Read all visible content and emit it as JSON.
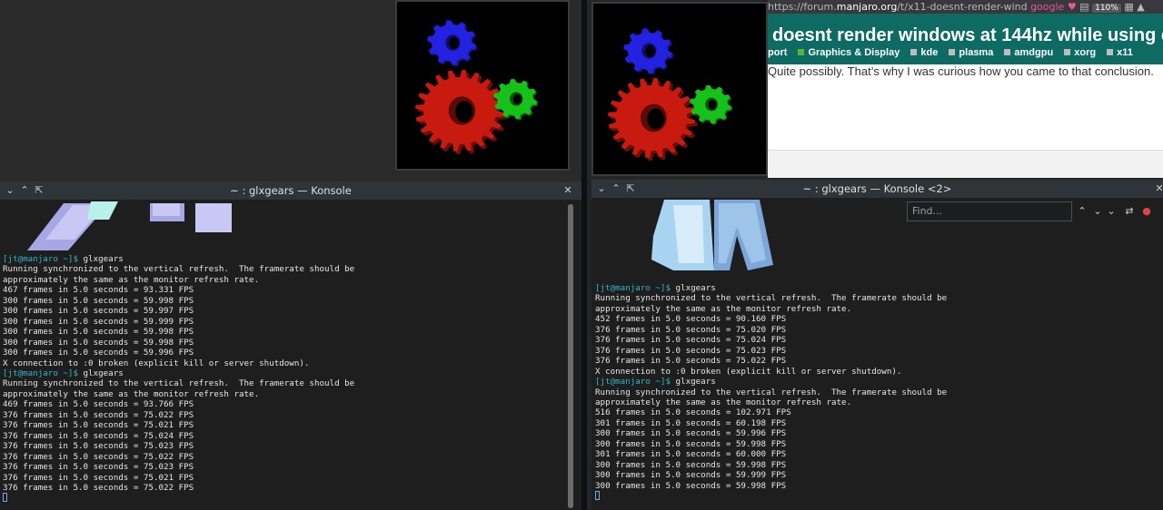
{
  "colors": {
    "blue_gear": "#2222e0",
    "red_gear": "#c91a0f",
    "green_gear": "#16c21a",
    "prompt": "#2fb6c7",
    "topic_bar": "#0d6b63"
  },
  "browser": {
    "url_prefix": "https://forum.",
    "url_domain": "manjaro.org",
    "url_path": "/t/x11-doesnt-render-wind",
    "search_engine": "google",
    "zoom": "110%",
    "topic_title": "doesnt render windows at 144hz while using d",
    "tags": [
      "port",
      "Graphics & Display",
      "kde",
      "plasma",
      "amdgpu",
      "xorg",
      "x11"
    ],
    "post_text": "Quite possibly. That’s why I was curious how you came to that conclusion."
  },
  "konsole_left": {
    "title": "~ : glxgears — Konsole",
    "lines": [
      {
        "prompt": "[jt@manjaro ~]$",
        "cmd": " glxgears"
      },
      {
        "text": "Running synchronized to the vertical refresh.  The framerate should be"
      },
      {
        "text": "approximately the same as the monitor refresh rate."
      },
      {
        "text": "467 frames in 5.0 seconds = 93.331 FPS"
      },
      {
        "text": "300 frames in 5.0 seconds = 59.998 FPS"
      },
      {
        "text": "300 frames in 5.0 seconds = 59.997 FPS"
      },
      {
        "text": "300 frames in 5.0 seconds = 59.999 FPS"
      },
      {
        "text": "300 frames in 5.0 seconds = 59.998 FPS"
      },
      {
        "text": "300 frames in 5.0 seconds = 59.998 FPS"
      },
      {
        "text": "300 frames in 5.0 seconds = 59.996 FPS"
      },
      {
        "text": "X connection to :0 broken (explicit kill or server shutdown)."
      },
      {
        "prompt": "[jt@manjaro ~]$",
        "cmd": " glxgears"
      },
      {
        "text": "Running synchronized to the vertical refresh.  The framerate should be"
      },
      {
        "text": "approximately the same as the monitor refresh rate."
      },
      {
        "text": "469 frames in 5.0 seconds = 93.766 FPS"
      },
      {
        "text": "376 frames in 5.0 seconds = 75.022 FPS"
      },
      {
        "text": "376 frames in 5.0 seconds = 75.021 FPS"
      },
      {
        "text": "376 frames in 5.0 seconds = 75.024 FPS"
      },
      {
        "text": "376 frames in 5.0 seconds = 75.023 FPS"
      },
      {
        "text": "376 frames in 5.0 seconds = 75.022 FPS"
      },
      {
        "text": "376 frames in 5.0 seconds = 75.023 FPS"
      },
      {
        "text": "376 frames in 5.0 seconds = 75.021 FPS"
      },
      {
        "text": "376 frames in 5.0 seconds = 75.022 FPS"
      },
      {
        "cursor": true
      }
    ]
  },
  "konsole_right": {
    "title": "~ : glxgears — Konsole <2>",
    "find_placeholder": "Find...",
    "lines": [
      {
        "prompt": "[jt@manjaro ~]$",
        "cmd": " glxgears"
      },
      {
        "text": "Running synchronized to the vertical refresh.  The framerate should be"
      },
      {
        "text": "approximately the same as the monitor refresh rate."
      },
      {
        "text": "452 frames in 5.0 seconds = 90.160 FPS"
      },
      {
        "text": "376 frames in 5.0 seconds = 75.020 FPS"
      },
      {
        "text": "376 frames in 5.0 seconds = 75.024 FPS"
      },
      {
        "text": "376 frames in 5.0 seconds = 75.023 FPS"
      },
      {
        "text": "376 frames in 5.0 seconds = 75.022 FPS"
      },
      {
        "text": "X connection to :0 broken (explicit kill or server shutdown)."
      },
      {
        "prompt": "[jt@manjaro ~]$",
        "cmd": " glxgears"
      },
      {
        "text": "Running synchronized to the vertical refresh.  The framerate should be"
      },
      {
        "text": "approximately the same as the monitor refresh rate."
      },
      {
        "text": "516 frames in 5.0 seconds = 102.971 FPS"
      },
      {
        "text": "301 frames in 5.0 seconds = 60.198 FPS"
      },
      {
        "text": "300 frames in 5.0 seconds = 59.996 FPS"
      },
      {
        "text": "300 frames in 5.0 seconds = 59.998 FPS"
      },
      {
        "text": "301 frames in 5.0 seconds = 60.000 FPS"
      },
      {
        "text": "300 frames in 5.0 seconds = 59.998 FPS"
      },
      {
        "text": "300 frames in 5.0 seconds = 59.999 FPS"
      },
      {
        "text": "300 frames in 5.0 seconds = 59.998 FPS"
      },
      {
        "cursor": true
      }
    ]
  }
}
